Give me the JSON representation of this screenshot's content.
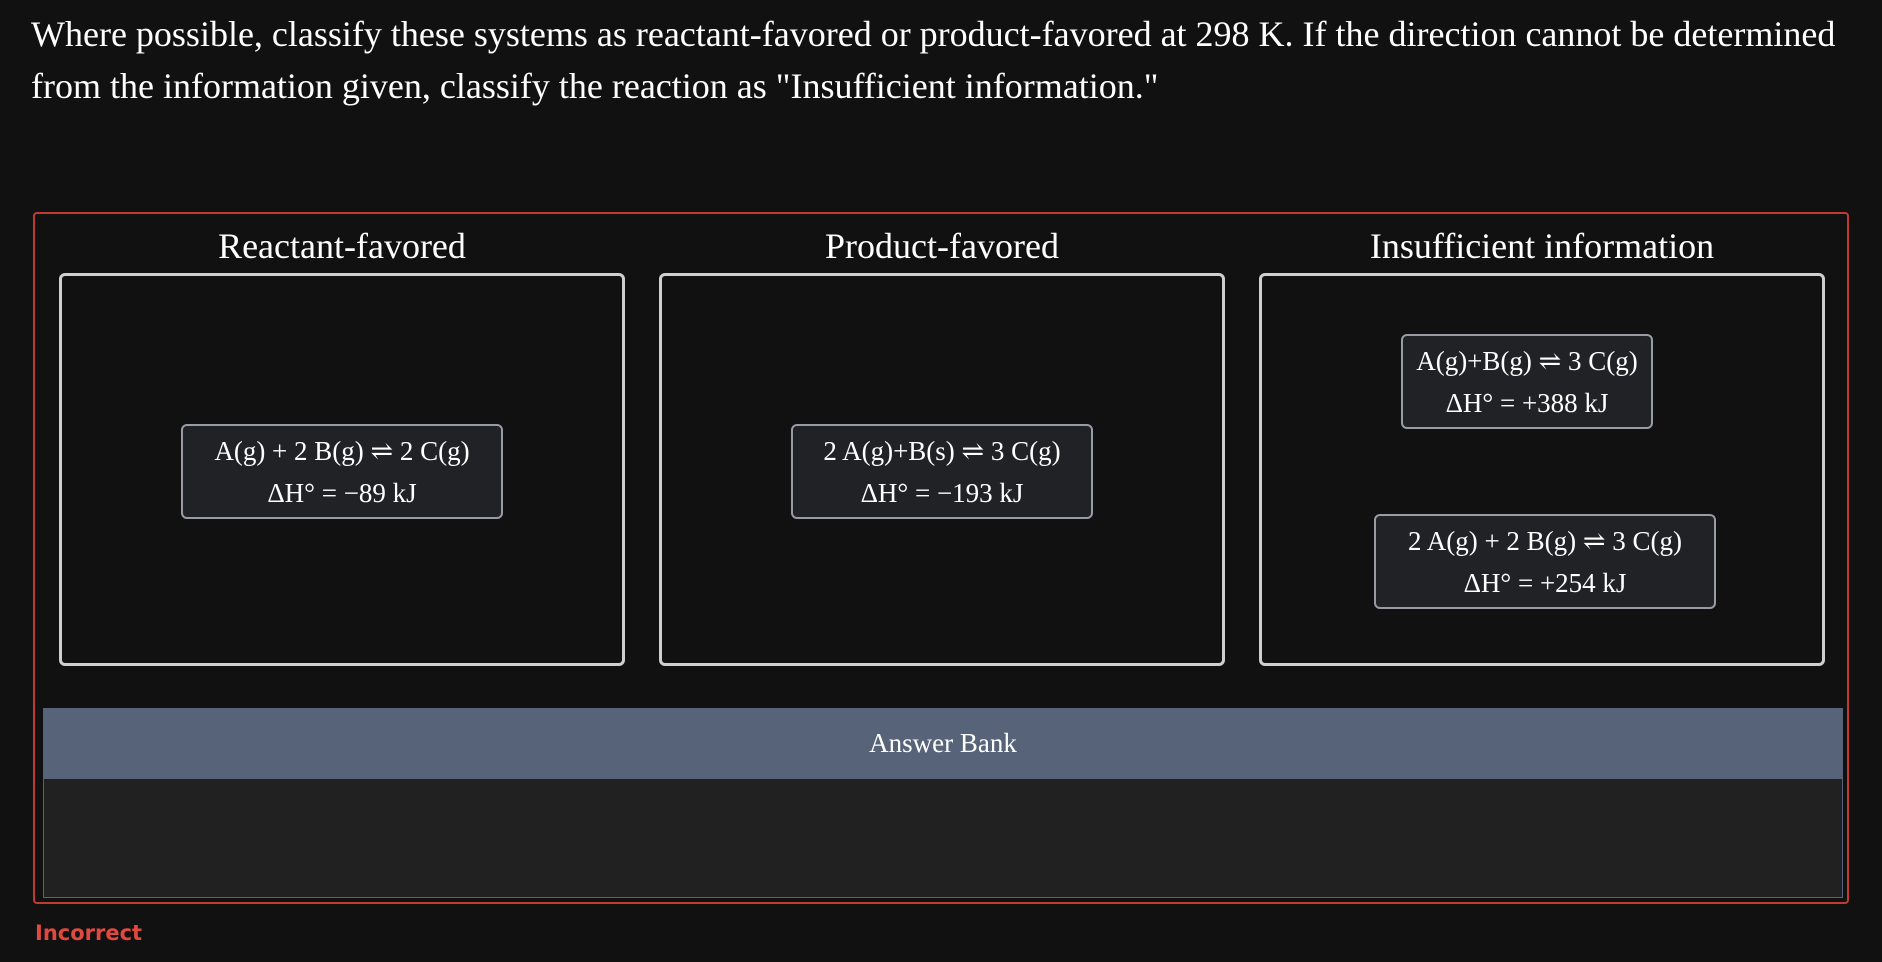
{
  "question": {
    "prompt_line1": "Where possible, classify these systems as reactant-favored or product-favored at 298 K. If the direction cannot be determined",
    "prompt_line2": "from the information given, classify the reaction as \"Insufficient information.\""
  },
  "bins": [
    {
      "title": "Reactant-favored",
      "cards": [
        {
          "equation": "A(g) + 2 B(g) ⇌ 2 C(g)",
          "enthalpy": "ΔH° = −89 kJ"
        }
      ]
    },
    {
      "title": "Product-favored",
      "cards": [
        {
          "equation": "2 A(g)+B(s) ⇌ 3 C(g)",
          "enthalpy": "ΔH° = −193 kJ"
        }
      ]
    },
    {
      "title": "Insufficient information",
      "cards": [
        {
          "equation": "A(g)+B(g) ⇌ 3 C(g)",
          "enthalpy": "ΔH° = +388 kJ"
        },
        {
          "equation": "2 A(g) + 2 B(g) ⇌ 3 C(g)",
          "enthalpy": "ΔH° = +254 kJ"
        }
      ]
    }
  ],
  "answer_bank": {
    "title": "Answer Bank"
  },
  "status": {
    "text": "Incorrect",
    "color": "#e0493f"
  },
  "colors": {
    "background": "#111112",
    "error_border": "#c23b33",
    "bank_header": "#566379",
    "card_bg": "#212225"
  }
}
